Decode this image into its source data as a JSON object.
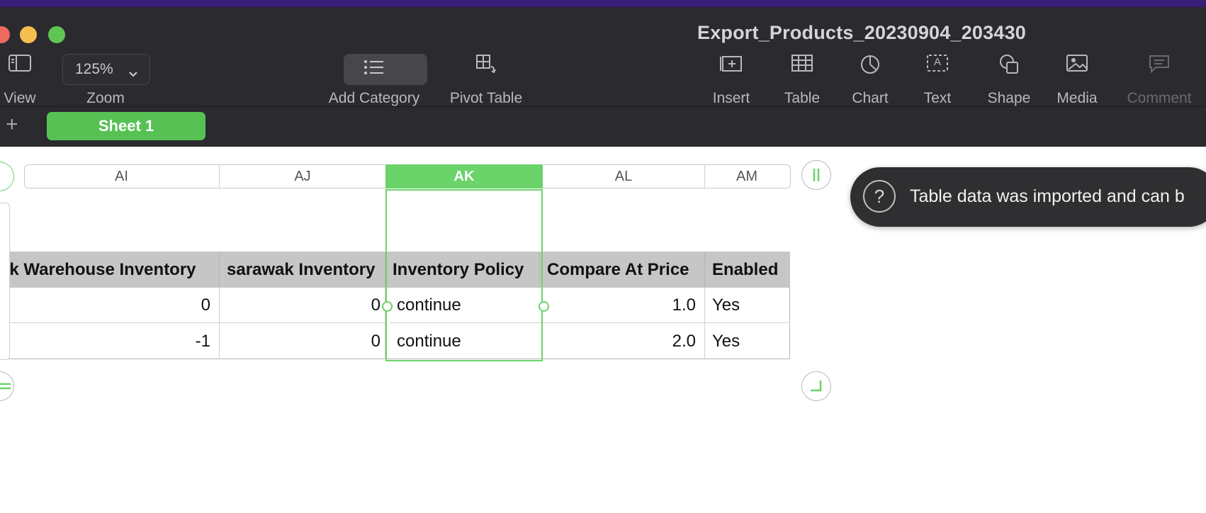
{
  "window": {
    "title": "Export_Products_20230904_203430"
  },
  "toolbar": {
    "view_label": "View",
    "zoom_label": "Zoom",
    "zoom_value": "125%",
    "add_category_label": "Add Category",
    "pivot_table_label": "Pivot Table",
    "insert_label": "Insert",
    "table_label": "Table",
    "chart_label": "Chart",
    "text_label": "Text",
    "text_icon_glyph": "A",
    "shape_label": "Shape",
    "media_label": "Media",
    "comment_label": "Comment"
  },
  "sheets": {
    "add": "+",
    "active": "Sheet 1"
  },
  "columns": [
    "AI",
    "AJ",
    "AK",
    "AL",
    "AM"
  ],
  "table": {
    "headers": [
      "ak Warehouse Inventory",
      "sarawak Inventory",
      "Inventory Policy",
      "Compare At Price",
      "Enabled"
    ],
    "rows": [
      [
        "0",
        "0",
        "continue",
        "1.0",
        "Yes"
      ],
      [
        "-1",
        "0",
        "continue",
        "2.0",
        "Yes"
      ]
    ]
  },
  "toast": {
    "icon": "?",
    "message": "Table data was imported and can b"
  },
  "colors": {
    "accent_green": "#57c253",
    "selection_green": "#6ad36a",
    "toolbar_bg": "#2b2a2f"
  }
}
